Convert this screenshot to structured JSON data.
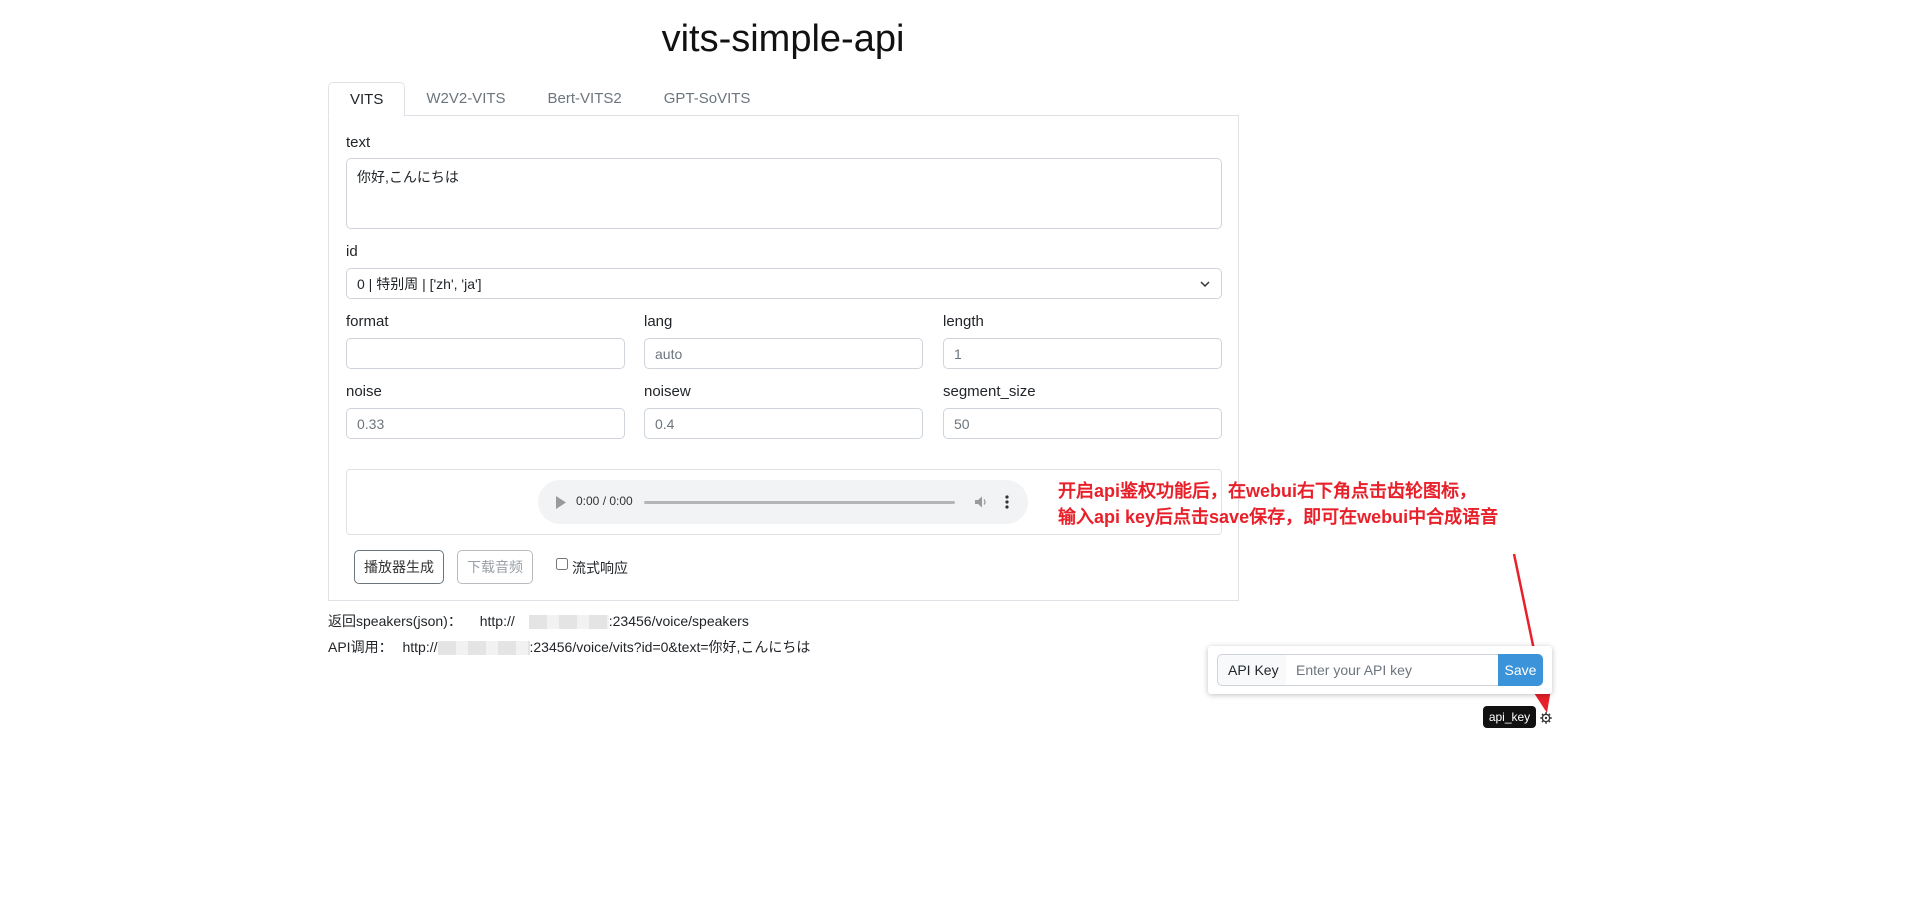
{
  "app": {
    "title": "vits-simple-api"
  },
  "tabs": [
    {
      "label": "VITS",
      "active": true
    },
    {
      "label": "W2V2-VITS",
      "active": false
    },
    {
      "label": "Bert-VITS2",
      "active": false
    },
    {
      "label": "GPT-SoVITS",
      "active": false
    }
  ],
  "form": {
    "text_label": "text",
    "text_value": "你好,こんにちは",
    "id_label": "id",
    "id_value": "0 | 特别周 | ['zh', 'ja']",
    "format_label": "format",
    "format_value": "",
    "lang_label": "lang",
    "lang_placeholder": "auto",
    "length_label": "length",
    "length_placeholder": "1",
    "noise_label": "noise",
    "noise_placeholder": "0.33",
    "noisew_label": "noisew",
    "noisew_placeholder": "0.4",
    "segment_label": "segment_size",
    "segment_placeholder": "50"
  },
  "player": {
    "time": "0:00 / 0:00",
    "progress": 0
  },
  "actions": {
    "generate_label": "播放器生成",
    "download_label": "下载音频",
    "stream_label": "流式响应",
    "stream_checked": false
  },
  "links": {
    "speakers_label": "返回speakers(json)：",
    "speakers_prefix": "http://",
    "speakers_suffix": ":23456/voice/speakers",
    "api_label": "API调用：",
    "api_prefix": "http://",
    "api_suffix": ":23456/voice/vits?id=0&text=你好,こんにちは"
  },
  "annotation": {
    "line1": "开启api鉴权功能后，在webui右下角点击齿轮图标，",
    "line2": "输入api key后点击save保存，即可在webui中合成语音"
  },
  "apikey": {
    "label": "API Key",
    "placeholder": "Enter your API key",
    "save_label": "Save",
    "tooltip": "api_key"
  },
  "icons": {
    "settings": "gear-icon",
    "play": "play-icon",
    "volume": "volume-icon",
    "more": "more-vertical-icon",
    "dropdown": "chevron-down-icon"
  },
  "colors": {
    "save_button": "#3b94d9",
    "annotation": "#e8202a",
    "tooltip_bg": "#111111"
  }
}
